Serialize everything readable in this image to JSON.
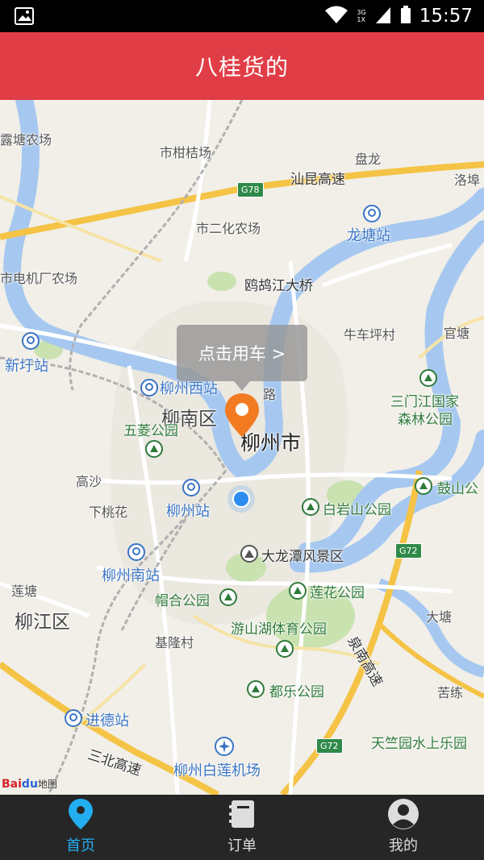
{
  "status_bar": {
    "time": "15:57",
    "network_top": "3G",
    "network_bottom": "1X",
    "icons": [
      "image-icon",
      "wifi-icon",
      "signal-icon",
      "battery-icon"
    ]
  },
  "header": {
    "title": "八桂货的"
  },
  "map": {
    "callout_text": "点击用车 >",
    "labels": {
      "nongchang1": "露塘农场",
      "shigan": "市柑桔场",
      "panlong": "盘龙",
      "luobu": "洛埠",
      "shanyun": "汕昆高速",
      "shierhua": "市二化农场",
      "longtang": "龙塘站",
      "dianjichang": "市电机厂农场",
      "quejiang": "鸥鸪江大桥",
      "niuche": "牛车坪村",
      "guantang": "官塘",
      "xinyu": "新圩站",
      "liuzhou_west": "柳州西站",
      "lu": "路",
      "liunan": "柳南区",
      "sanmen": "三门江国家",
      "sanmen2": "森林公园",
      "wuling": "五菱公园",
      "city": "柳州市",
      "gaosha": "高沙",
      "guoshan": "鼓山公",
      "xiataohua": "下桃花",
      "liuzhou_station": "柳州站",
      "baiyan": "白岩山公园",
      "liuzhou_south": "柳州南站",
      "dalongtan": "大龙潭风景区",
      "liantang": "莲塘",
      "maohe": "帽合公园",
      "lianhua": "莲花公园",
      "datang": "大塘",
      "liujiang": "柳江区",
      "youshan": "游山湖体育公园",
      "jilong": "基隆村",
      "quannan": "泉南高速",
      "dule": "都乐公园",
      "kulian": "苦练",
      "jinde": "进德站",
      "tianzhu": "天竺园水上乐园",
      "sanbei": "三北高速",
      "airport": "柳州白莲机场"
    },
    "shields": {
      "g78": "G78",
      "g72a": "G72",
      "g72b": "G72"
    },
    "logo_text": "Bai",
    "logo_paw": "du",
    "logo_suffix": "地图",
    "colors": {
      "water": "#a6c8f0",
      "highway": "#f5c345",
      "park": "#c9e2b0"
    }
  },
  "tabs": [
    {
      "label": "首页",
      "icon": "location-pin-icon",
      "active": true
    },
    {
      "label": "订单",
      "icon": "order-book-icon",
      "active": false
    },
    {
      "label": "我的",
      "icon": "user-profile-icon",
      "active": false
    }
  ]
}
